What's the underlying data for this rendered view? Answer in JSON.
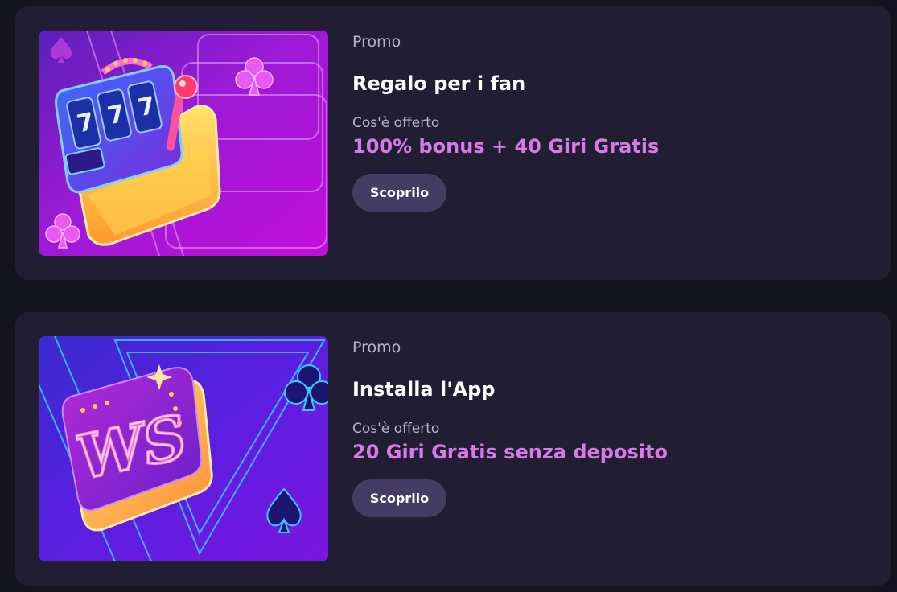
{
  "promos": [
    {
      "label": "Promo",
      "title": "Regalo per i fan",
      "offer_label": "Cos'è offerto",
      "offer_value": "100% bonus + 40 Giri Gratis",
      "button_label": "Scoprilo",
      "image_icon": "slot-machine-icon"
    },
    {
      "label": "Promo",
      "title": "Installa l'App",
      "offer_label": "Cos'è offerto",
      "offer_value": "20 Giri Gratis senza deposito",
      "button_label": "Scoprilo",
      "image_icon": "ws-app-logo-icon"
    }
  ],
  "colors": {
    "page_bg": "#141320",
    "card_bg": "#211d33",
    "accent": "#d77ae6",
    "button_bg": "#453c63"
  }
}
